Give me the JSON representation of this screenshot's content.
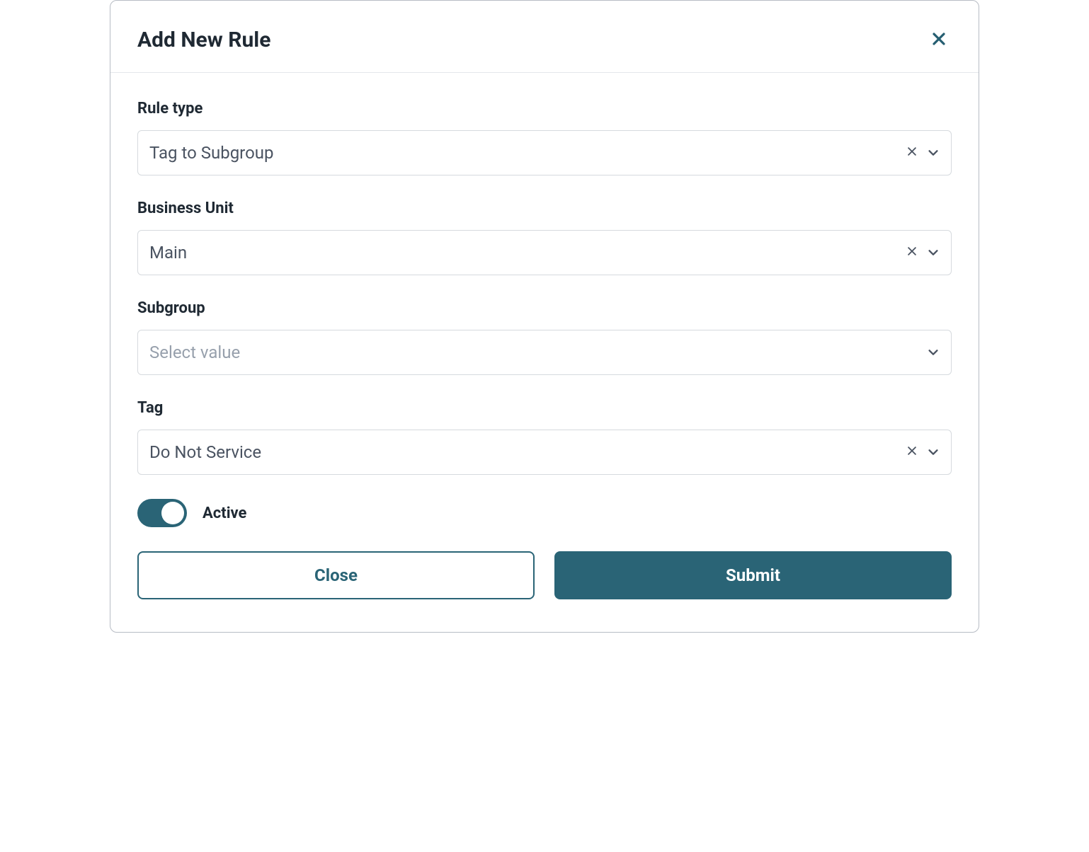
{
  "modal": {
    "title": "Add New Rule",
    "fields": {
      "ruleType": {
        "label": "Rule type",
        "value": "Tag to Subgroup",
        "hasClear": true
      },
      "businessUnit": {
        "label": "Business Unit",
        "value": "Main",
        "hasClear": true
      },
      "subgroup": {
        "label": "Subgroup",
        "placeholder": "Select value",
        "hasClear": false
      },
      "tag": {
        "label": "Tag",
        "value": "Do Not Service",
        "hasClear": true
      }
    },
    "toggle": {
      "label": "Active",
      "on": true
    },
    "buttons": {
      "close": "Close",
      "submit": "Submit"
    }
  }
}
